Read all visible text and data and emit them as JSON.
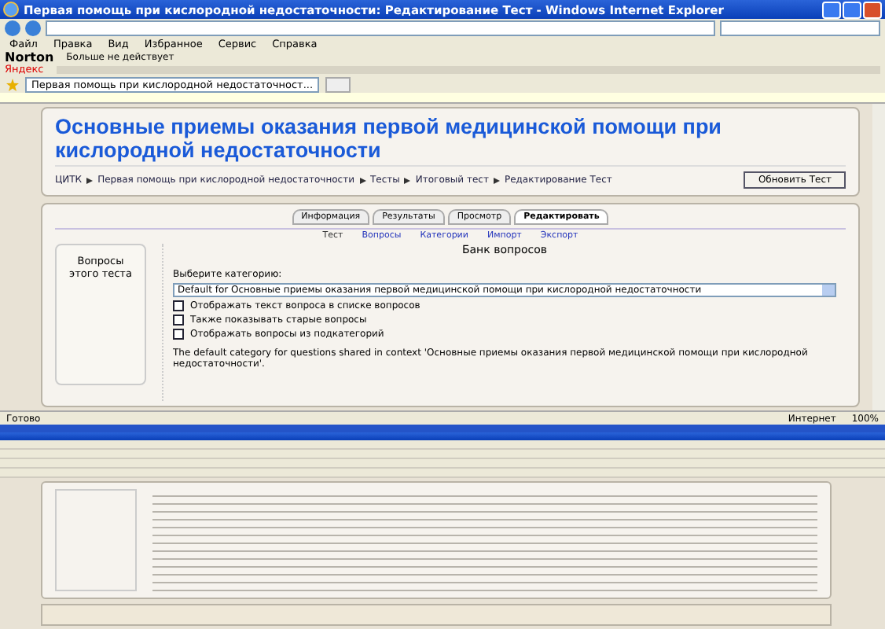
{
  "window": {
    "title": "Первая помощь при кислородной недостаточности: Редактирование Тест - Windows Internet Explorer"
  },
  "menu": [
    "Файл",
    "Правка",
    "Вид",
    "Избранное",
    "Сервис",
    "Справка"
  ],
  "toolbar": {
    "norton": "Norton",
    "norton_status": "Больше не действует",
    "yandex": "Яндекс"
  },
  "browser_tab": {
    "title": "Первая помощь при кислородной недостаточност...",
    "selected": true
  },
  "page": {
    "heading": "Основные приемы оказания первой медицинской помощи при кислородной недостаточности",
    "breadcrumbs": [
      "ЦИТК",
      "Первая помощь при кислородной недостаточности",
      "Тесты",
      "Итоговый тест",
      "Редактирование Тест"
    ],
    "update_button": "Обновить Тест",
    "tabs": [
      {
        "label": "Информация",
        "selected": false
      },
      {
        "label": "Результаты",
        "selected": false
      },
      {
        "label": "Просмотр",
        "selected": false
      },
      {
        "label": "Редактировать",
        "selected": true
      }
    ],
    "subtabs": [
      {
        "label": "Тест",
        "selected": true
      },
      {
        "label": "Вопросы",
        "selected": false
      },
      {
        "label": "Категории",
        "selected": false
      },
      {
        "label": "Импорт",
        "selected": false
      },
      {
        "label": "Экспорт",
        "selected": false
      }
    ],
    "side_block": {
      "title": "Вопросы этого теста"
    },
    "bank": {
      "title": "Банк вопросов",
      "category_label": "Выберите категорию:",
      "category": "Default for Основные приемы оказания первой медицинской помощи при кислородной недостаточности",
      "options": [
        {
          "label": "Отображать текст вопроса в списке вопросов",
          "checked": false
        },
        {
          "label": "Также показывать старые вопросы",
          "checked": false
        },
        {
          "label": "Отображать вопросы из подкатегорий",
          "checked": false
        }
      ],
      "description": "The default category for questions shared in context 'Основные приемы оказания первой медицинской помощи при кислородной недостаточности'."
    }
  },
  "status_bar": {
    "status": "Готово",
    "zone": "Интернет",
    "zoom": "100%"
  }
}
